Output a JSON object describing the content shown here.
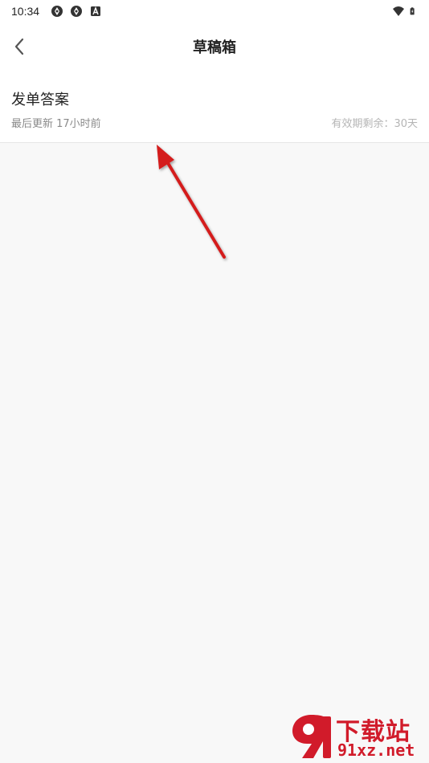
{
  "status_bar": {
    "time": "10:34",
    "left_icons": [
      "sync-icon",
      "sync-icon",
      "app-a-icon"
    ],
    "right_icons": [
      "wifi-icon",
      "battery-charging-icon"
    ]
  },
  "header": {
    "title": "草稿箱",
    "back_icon": "chevron-left-icon"
  },
  "drafts": [
    {
      "title": "发单答案",
      "updated": "最后更新  17小时前",
      "expiry": "有效期剩余：30天"
    }
  ],
  "watermark": {
    "logo_text": "下载站",
    "site": "91xz.net"
  },
  "colors": {
    "accent_red": "#d11b2a",
    "background": "#f8f8f8"
  }
}
